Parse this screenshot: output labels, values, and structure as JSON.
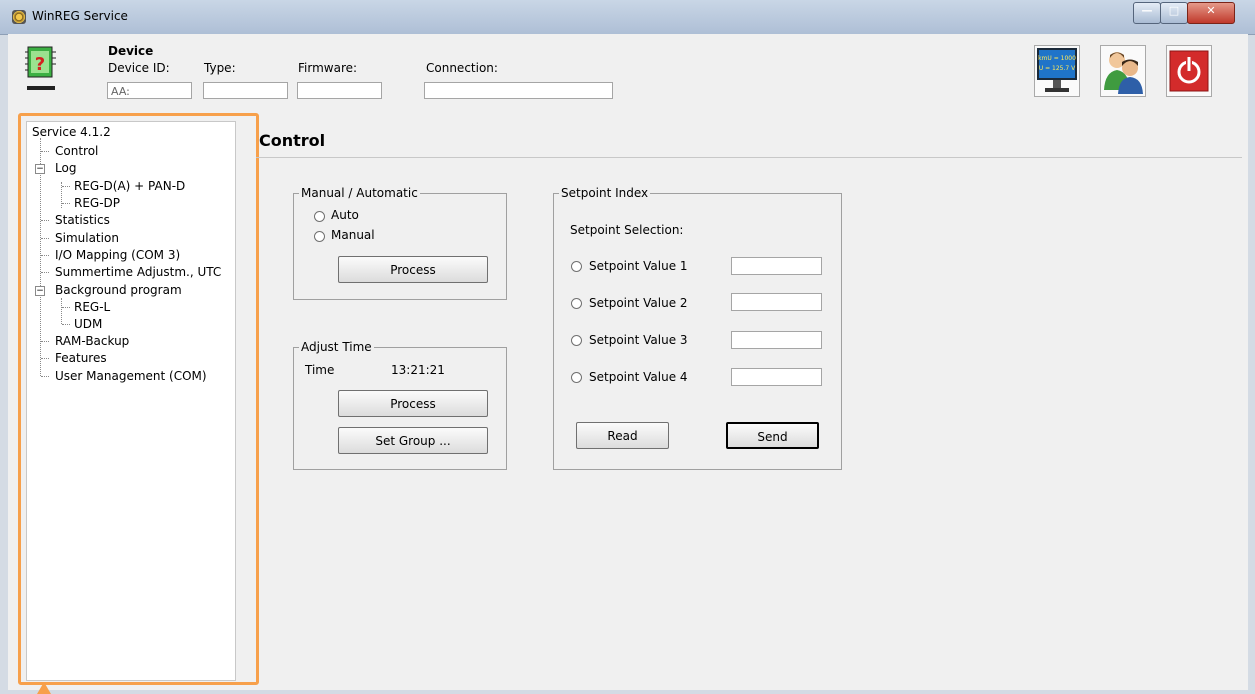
{
  "window": {
    "title": "WinREG Service"
  },
  "device": {
    "heading": "Device",
    "device_id_label": "Device ID:",
    "device_id_value": "AA:",
    "type_label": "Type:",
    "type_value": "",
    "firmware_label": "Firmware:",
    "firmware_value": "",
    "connection_label": "Connection:",
    "connection_value": ""
  },
  "toolbar": {
    "monitor_line1": "kmU = 1000",
    "monitor_line2": "U = 125.7 V"
  },
  "tree": {
    "root": "Service 4.1.2",
    "items": [
      {
        "label": "Control"
      },
      {
        "label": "Log"
      },
      {
        "label": "REG-D(A) + PAN-D"
      },
      {
        "label": "REG-DP"
      },
      {
        "label": "Statistics"
      },
      {
        "label": "Simulation"
      },
      {
        "label": "I/O Mapping (COM 3)"
      },
      {
        "label": "Summertime Adjustm., UTC"
      },
      {
        "label": "Background program"
      },
      {
        "label": "REG-L"
      },
      {
        "label": "UDM"
      },
      {
        "label": "RAM-Backup"
      },
      {
        "label": "Features"
      },
      {
        "label": "User Management (COM)"
      }
    ]
  },
  "section": {
    "title": "Control"
  },
  "manual_auto": {
    "legend": "Manual / Automatic",
    "auto_label": "Auto",
    "manual_label": "Manual",
    "process_label": "Process"
  },
  "adjust_time": {
    "legend": "Adjust Time",
    "time_label": "Time",
    "time_value": "13:21:21",
    "process_label": "Process",
    "set_group_label": "Set Group ..."
  },
  "setpoint": {
    "legend": "Setpoint Index",
    "selection_label": "Setpoint Selection:",
    "values": [
      {
        "label": "Setpoint Value 1",
        "value": ""
      },
      {
        "label": "Setpoint Value 2",
        "value": ""
      },
      {
        "label": "Setpoint Value 3",
        "value": ""
      },
      {
        "label": "Setpoint Value 4",
        "value": ""
      }
    ],
    "read_label": "Read",
    "send_label": "Send"
  }
}
